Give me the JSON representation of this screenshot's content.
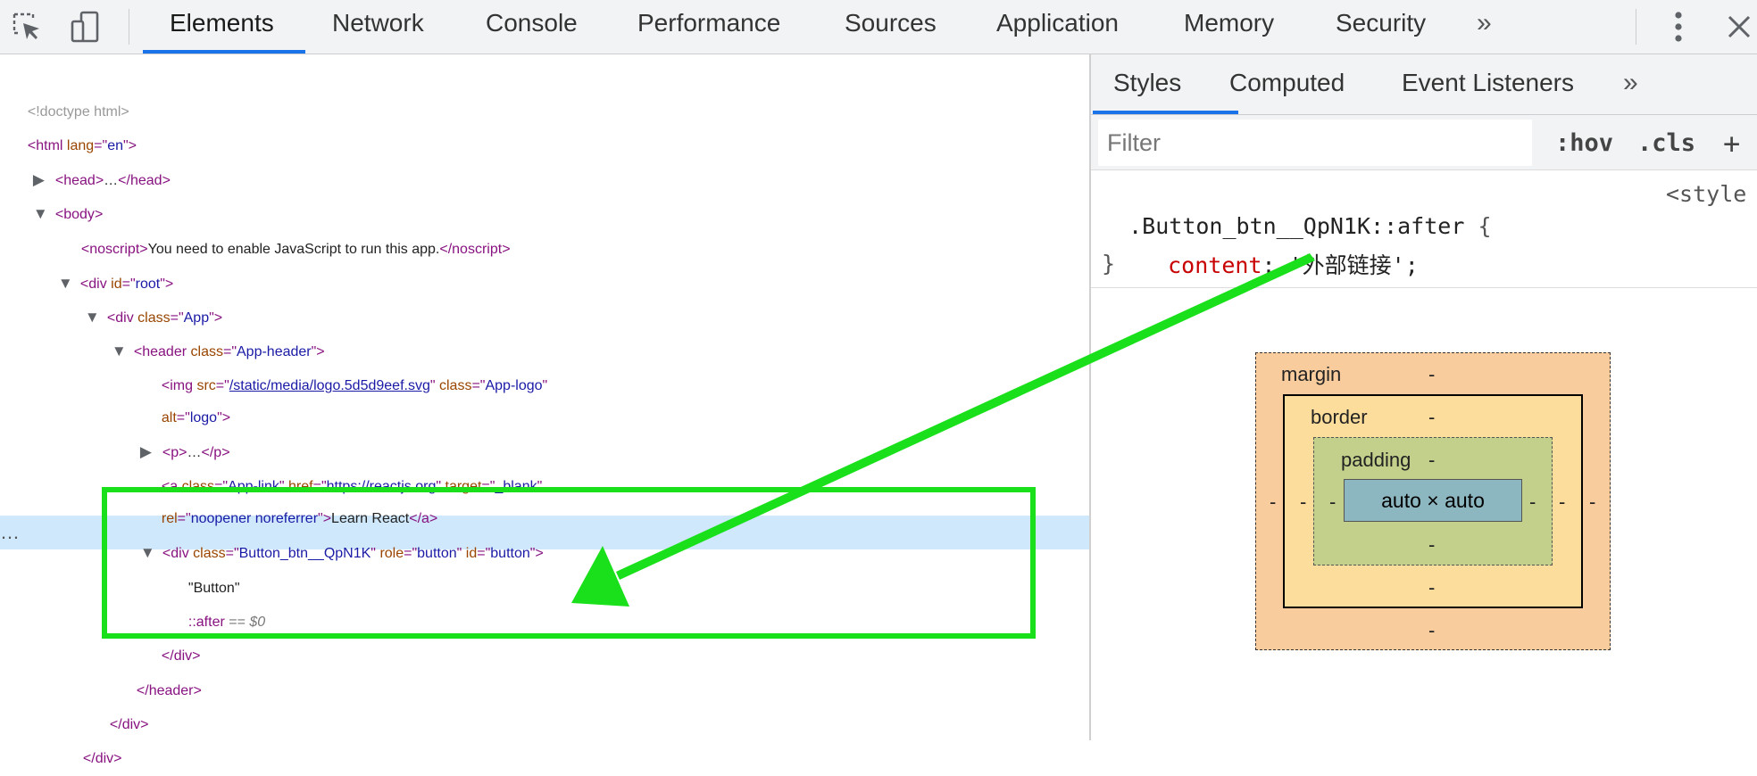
{
  "toolbar": {
    "tabs": [
      "Elements",
      "Network",
      "Console",
      "Performance",
      "Sources",
      "Application",
      "Memory",
      "Security"
    ],
    "more": "»",
    "active_tab": "Elements"
  },
  "dom": {
    "doctype": "<!doctype html>",
    "html_tag": "html",
    "lang_attr": "lang",
    "lang_val": "en",
    "head_tag": "head",
    "ellipsis": "…",
    "body_tag": "body",
    "noscript_tag": "noscript",
    "noscript_text": "You need to enable JavaScript to run this app.",
    "div_tag": "div",
    "id_attr": "id",
    "root_val": "root",
    "class_attr": "class",
    "app_val": "App",
    "header_tag": "header",
    "app_header_val": "App-header",
    "img_tag": "img",
    "src_attr": "src",
    "logo_src": "/static/media/logo.5d5d9eef.svg",
    "app_logo_val": "App-logo",
    "alt_attr": "alt",
    "alt_val": "logo",
    "p_tag": "p",
    "a_tag": "a",
    "app_link_val": "App-link",
    "href_attr": "href",
    "href_val": "https://reactjs.org",
    "target_attr": "target",
    "target_val": "_blank",
    "rel_attr": "rel",
    "rel_val": "noopener noreferrer",
    "link_text": "Learn React",
    "btn_class_val": "Button_btn__QpN1K",
    "role_attr": "role",
    "role_val": "button",
    "button_id_val": "button",
    "button_text": "\"Button\"",
    "after_pseudo": "::after",
    "after_eq": "==",
    "after_var": "$0",
    "row_dots": "…"
  },
  "styles": {
    "tabs": [
      "Styles",
      "Computed",
      "Event Listeners"
    ],
    "more": "»",
    "filter_placeholder": "Filter",
    "hov": ":hov",
    "cls": ".cls",
    "plus": "+",
    "selector": ".Button_btn__QpN1K::after",
    "open_brace": "{",
    "source": "<style",
    "prop": "content",
    "prop_value": "'外部链接'",
    "close_brace": "}"
  },
  "box_model": {
    "margin_label": "margin",
    "border_label": "border",
    "padding_label": "padding",
    "dash": "-",
    "content_label": "auto × auto"
  },
  "colors": {
    "accent": "#1a73e8",
    "annotation": "#19e01b",
    "selected_row": "#cfe8fc"
  }
}
